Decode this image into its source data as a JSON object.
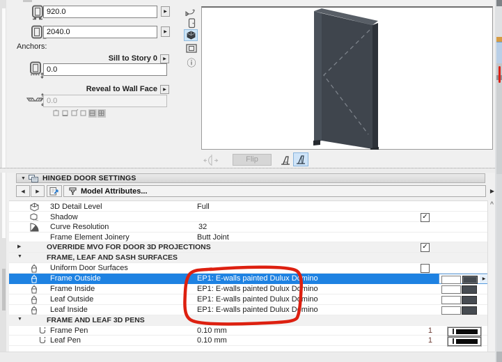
{
  "colors": {
    "selection_blue": "#1e82e2",
    "annotation_red": "#dd2010",
    "panel_gray": "#f0f0f0",
    "preview_select_blue": "#cde5f7"
  },
  "icons": {
    "expand_down": "▼",
    "expand_right": "▶",
    "prev": "◀",
    "next": "▶",
    "flyout": "▶",
    "check": "✓",
    "scroll_up": "^",
    "info": "ⓘ"
  },
  "left_panel": {
    "width_value": "920.0",
    "height_value": "2040.0",
    "anchors_label": "Anchors:",
    "sill_anchor_label": "Sill to Story 0",
    "sill_value": "0.0",
    "reveal_anchor_label": "Reveal to Wall Face",
    "reveal_value": "0.0"
  },
  "preview": {
    "flip_label": "Flip"
  },
  "settings_header": {
    "title": "HINGED DOOR SETTINGS"
  },
  "nav": {
    "tab_label": "Model Attributes..."
  },
  "table": {
    "rows": [
      {
        "label": "3D Detail Level",
        "value": "Full"
      },
      {
        "label": "Shadow",
        "checked": true
      },
      {
        "label": "Curve Resolution",
        "value": "32"
      },
      {
        "label": "Frame Element Joinery",
        "value": "Butt Joint"
      },
      {
        "label": "OVERRIDE MVO FOR DOOR 3D PROJECTIONS",
        "checked": true
      },
      {
        "label": "FRAME, LEAF AND SASH SURFACES"
      },
      {
        "label": "Uniform Door Surfaces",
        "checked": false
      },
      {
        "label": "Frame Outside",
        "value": "EP1: E-walls painted Dulux Domino",
        "selected": true
      },
      {
        "label": "Frame Inside",
        "value": "EP1: E-walls painted Dulux Domino"
      },
      {
        "label": "Leaf Outside",
        "value": "EP1: E-walls painted Dulux Domino"
      },
      {
        "label": "Leaf Inside",
        "value": "EP1: E-walls painted Dulux Domino"
      },
      {
        "label": "FRAME AND LEAF 3D PENS"
      },
      {
        "label": "Frame Pen",
        "value": "0.10 mm",
        "pen_number": "1"
      },
      {
        "label": "Leaf Pen",
        "value": "0.10 mm",
        "pen_number": "1"
      }
    ]
  }
}
